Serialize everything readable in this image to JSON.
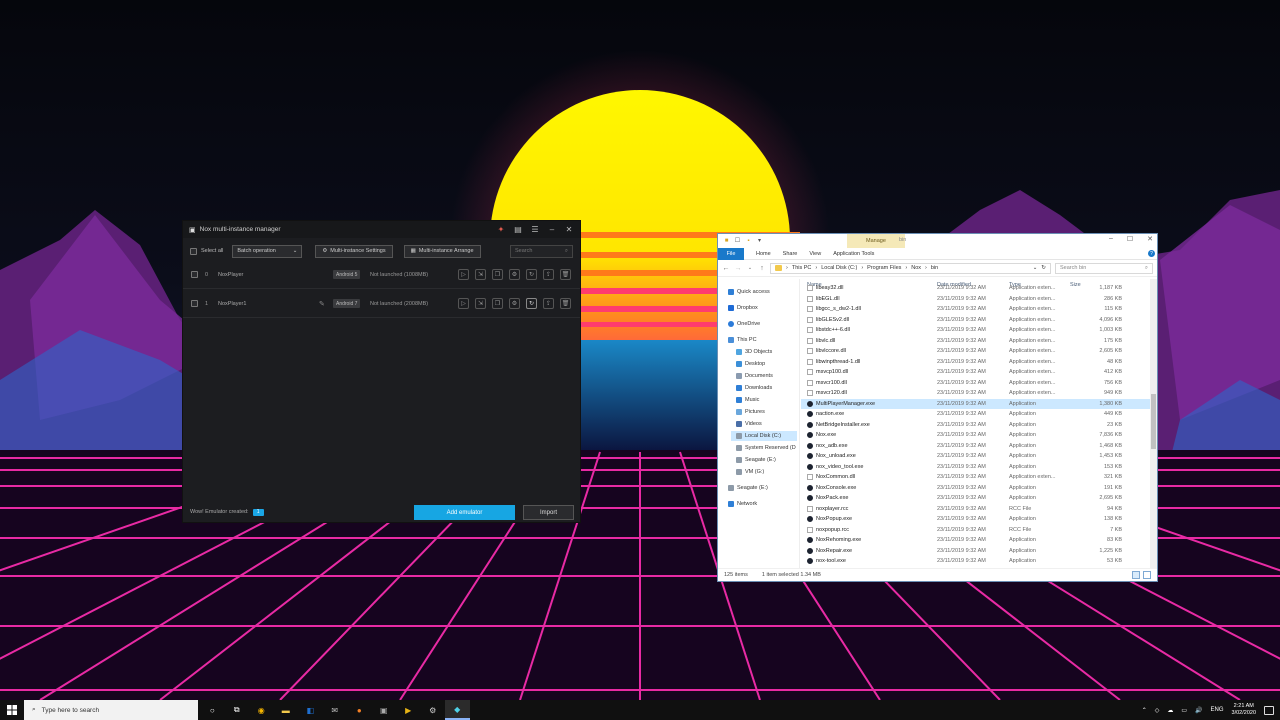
{
  "nox": {
    "title": "Nox multi-instance manager",
    "select_all": "Select all",
    "batch_operation": "Batch operation",
    "multi_instance_settings": "Multi-instance Settings",
    "multi_instance_arrange": "Multi-instance Arrange",
    "search_placeholder": "Search",
    "instances": [
      {
        "index": "0",
        "name": "NoxPlayer",
        "android": "Android 5",
        "status": "Not launched (1008MB)"
      },
      {
        "index": "1",
        "name": "NoxPlayer1",
        "android": "Android 7",
        "status": "Not launched (2008MB)"
      }
    ],
    "footer_message": "Wow! Emulator created:",
    "footer_badge": "1",
    "add_emulator": "Add emulator",
    "import": "Import"
  },
  "explorer": {
    "window_title": "bin",
    "manage_tab": "Manage",
    "tabs": {
      "file": "File",
      "home": "Home",
      "share": "Share",
      "view": "View",
      "app_tools": "Application Tools"
    },
    "breadcrumb": [
      "This PC",
      "Local Disk (C:)",
      "Program Files",
      "Nox",
      "bin"
    ],
    "search_placeholder": "Search bin",
    "columns": {
      "name": "Name",
      "date": "Date modified",
      "type": "Type",
      "size": "Size"
    },
    "nav": [
      "Quick access",
      "Dropbox",
      "OneDrive",
      "This PC",
      "3D Objects",
      "Desktop",
      "Documents",
      "Downloads",
      "Music",
      "Pictures",
      "Videos",
      "Local Disk (C:)",
      "System Reserved (D",
      "Seagate (E:)",
      "VM (G:)",
      "Seagate (E:)",
      "Network"
    ],
    "files": [
      {
        "name": "libeay32.dll",
        "date": "23/11/2019 9:32 AM",
        "type": "Application exten...",
        "size": "1,187 KB"
      },
      {
        "name": "libEGL.dll",
        "date": "23/11/2019 9:32 AM",
        "type": "Application exten...",
        "size": "286 KB"
      },
      {
        "name": "libgcc_s_dw2-1.dll",
        "date": "23/11/2019 9:32 AM",
        "type": "Application exten...",
        "size": "115 KB"
      },
      {
        "name": "libGLESv2.dll",
        "date": "23/11/2019 9:32 AM",
        "type": "Application exten...",
        "size": "4,096 KB"
      },
      {
        "name": "libstdc++-6.dll",
        "date": "23/11/2019 9:32 AM",
        "type": "Application exten...",
        "size": "1,003 KB"
      },
      {
        "name": "libvlc.dll",
        "date": "23/11/2019 9:32 AM",
        "type": "Application exten...",
        "size": "175 KB"
      },
      {
        "name": "libvlccore.dll",
        "date": "23/11/2019 9:32 AM",
        "type": "Application exten...",
        "size": "2,605 KB"
      },
      {
        "name": "libwinpthread-1.dll",
        "date": "23/11/2019 9:32 AM",
        "type": "Application exten...",
        "size": "48 KB"
      },
      {
        "name": "msvcp100.dll",
        "date": "23/11/2019 9:32 AM",
        "type": "Application exten...",
        "size": "412 KB"
      },
      {
        "name": "msvcr100.dll",
        "date": "23/11/2019 9:32 AM",
        "type": "Application exten...",
        "size": "756 KB"
      },
      {
        "name": "msvcr120.dll",
        "date": "23/11/2019 9:32 AM",
        "type": "Application exten...",
        "size": "949 KB"
      },
      {
        "name": "MultiPlayerManager.exe",
        "date": "23/11/2019 9:32 AM",
        "type": "Application",
        "size": "1,380 KB"
      },
      {
        "name": "naction.exe",
        "date": "23/11/2019 9:32 AM",
        "type": "Application",
        "size": "449 KB"
      },
      {
        "name": "NetBridgeInstaller.exe",
        "date": "23/11/2019 9:32 AM",
        "type": "Application",
        "size": "23 KB"
      },
      {
        "name": "Nox.exe",
        "date": "23/11/2019 9:32 AM",
        "type": "Application",
        "size": "7,836 KB"
      },
      {
        "name": "nox_adb.exe",
        "date": "23/11/2019 9:32 AM",
        "type": "Application",
        "size": "1,468 KB"
      },
      {
        "name": "Nox_unload.exe",
        "date": "23/11/2019 9:32 AM",
        "type": "Application",
        "size": "1,453 KB"
      },
      {
        "name": "nox_video_tool.exe",
        "date": "23/11/2019 9:32 AM",
        "type": "Application",
        "size": "153 KB"
      },
      {
        "name": "NoxCommon.dll",
        "date": "23/11/2019 9:32 AM",
        "type": "Application exten...",
        "size": "321 KB"
      },
      {
        "name": "NoxConsole.exe",
        "date": "23/11/2019 9:32 AM",
        "type": "Application",
        "size": "191 KB"
      },
      {
        "name": "NoxPack.exe",
        "date": "23/11/2019 9:32 AM",
        "type": "Application",
        "size": "2,695 KB"
      },
      {
        "name": "noxplayer.rcc",
        "date": "23/11/2019 9:32 AM",
        "type": "RCC File",
        "size": "94 KB"
      },
      {
        "name": "NoxPopup.exe",
        "date": "23/11/2019 9:32 AM",
        "type": "Application",
        "size": "138 KB"
      },
      {
        "name": "noxpopup.rcc",
        "date": "23/11/2019 9:32 AM",
        "type": "RCC File",
        "size": "7 KB"
      },
      {
        "name": "NoxRehoming.exe",
        "date": "23/11/2019 9:32 AM",
        "type": "Application",
        "size": "83 KB"
      },
      {
        "name": "NoxRepair.exe",
        "date": "23/11/2019 9:32 AM",
        "type": "Application",
        "size": "1,225 KB"
      },
      {
        "name": "nox-tool.exe",
        "date": "23/11/2019 9:32 AM",
        "type": "Application",
        "size": "53 KB"
      }
    ],
    "status_items": "125 items",
    "status_selected": "1 item selected  1.34 MB"
  },
  "taskbar": {
    "search_placeholder": "Type here to search",
    "lang": "ENG",
    "time": "2:21 AM",
    "date": "3/02/2020"
  }
}
